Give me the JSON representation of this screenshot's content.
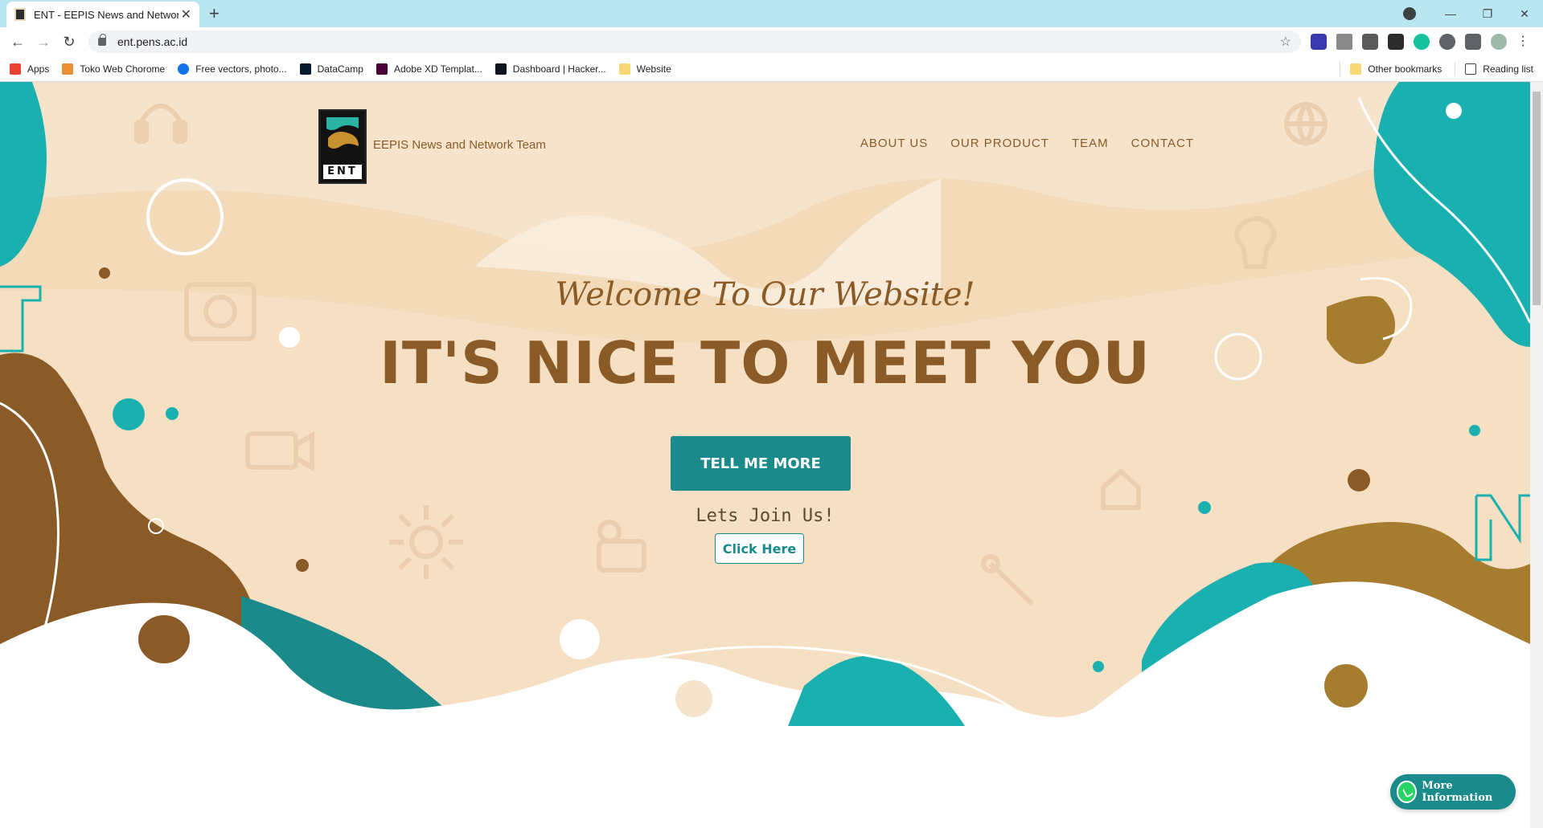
{
  "browser": {
    "tab_title": "ENT - EEPIS News and Network T",
    "url": "ent.pens.ac.id",
    "bookmarks": [
      {
        "label": "Apps",
        "icon": "apps-grid-icon",
        "color": "#ea4335"
      },
      {
        "label": "Toko Web Chorome",
        "icon": "chrome-web-store-icon",
        "color": "#ea8f35"
      },
      {
        "label": "Free vectors, photo...",
        "icon": "freepik-icon",
        "color": "#1273eb"
      },
      {
        "label": "DataCamp",
        "icon": "datacamp-icon",
        "color": "#03ef62"
      },
      {
        "label": "Adobe XD Templat...",
        "icon": "adobe-xd-icon",
        "color": "#470137"
      },
      {
        "label": "Dashboard | Hacker...",
        "icon": "hackerrank-icon",
        "color": "#0e141e"
      },
      {
        "label": "Website",
        "icon": "folder-icon",
        "color": "#f8d775"
      }
    ],
    "other_bookmarks": "Other bookmarks",
    "reading_list": "Reading list"
  },
  "site": {
    "brand": "EEPIS News and Network Team",
    "logo_text": "ENT",
    "nav": [
      "ABOUT US",
      "OUR PRODUCT",
      "TEAM",
      "CONTACT"
    ],
    "welcome": "Welcome To Our Website!",
    "headline": "IT'S NICE TO MEET YOU",
    "cta_label": "TELL ME MORE",
    "join_text": "Lets Join Us!",
    "join_button": "Click Here",
    "whatsapp_label": "More Information"
  },
  "colors": {
    "hero_bg": "#f6e3cc",
    "teal": "#1ab0b0",
    "dark_teal": "#1a8a8a",
    "brown": "#8a5a27",
    "gold": "#a67c2f"
  }
}
